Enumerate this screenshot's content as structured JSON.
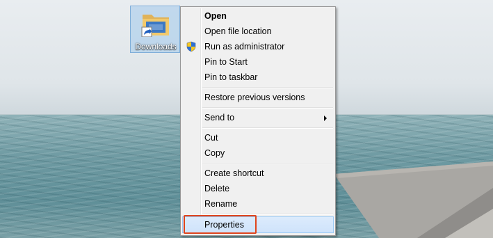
{
  "desktop": {
    "icon_label": "Downloads"
  },
  "context_menu": {
    "items": [
      {
        "label": "Open"
      },
      {
        "label": "Open file location"
      },
      {
        "label": "Run as administrator"
      },
      {
        "label": "Pin to Start"
      },
      {
        "label": "Pin to taskbar"
      },
      {
        "label": "Restore previous versions"
      },
      {
        "label": "Send to"
      },
      {
        "label": "Cut"
      },
      {
        "label": "Copy"
      },
      {
        "label": "Create shortcut"
      },
      {
        "label": "Delete"
      },
      {
        "label": "Rename"
      },
      {
        "label": "Properties"
      }
    ]
  },
  "icons": {
    "folder": "folder-shortcut-icon",
    "shield": "uac-shield-icon",
    "submenu": "submenu-arrow-icon"
  },
  "colors": {
    "highlight_border": "#e0441c",
    "hover_fill": "#cfe3fb",
    "menu_bg": "#f0f0f0"
  }
}
